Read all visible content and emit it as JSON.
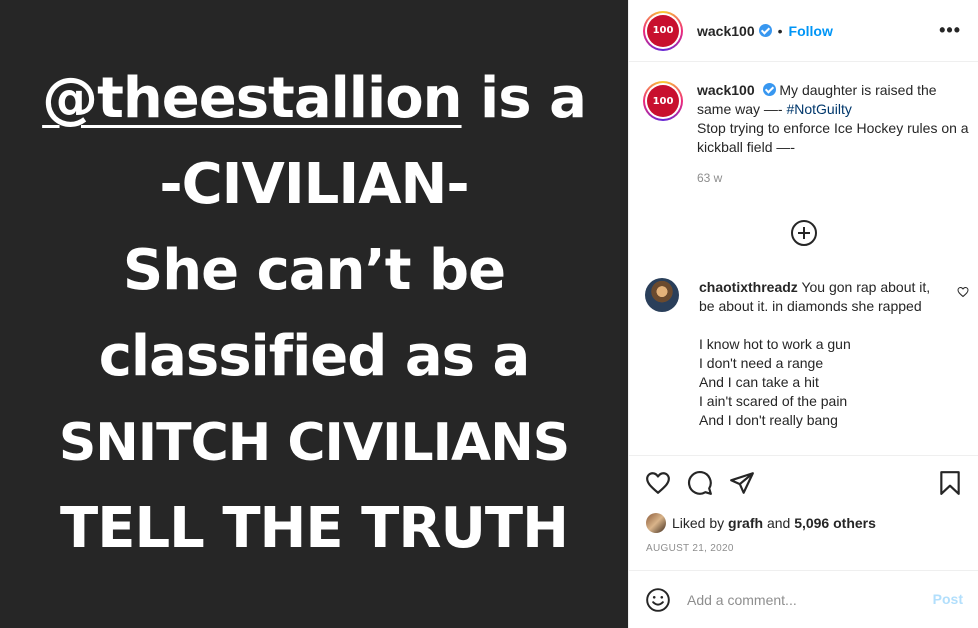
{
  "media": {
    "lines": {
      "mention": "@theestallion",
      "l1_rest": " is a",
      "l2": "-CIVILIAN-",
      "l3": "She can’t be",
      "l4": "classified as a",
      "l5": "SNITCH CIVILIANS",
      "l6": "TELL THE TRUTH"
    }
  },
  "header": {
    "username": "wack100",
    "separator": "•",
    "follow_label": "Follow",
    "more_label": "•••",
    "avatar_text": "100"
  },
  "caption": {
    "username": "wack100",
    "text_before_tag": "My daughter is raised the same way —- ",
    "hashtag": "#NotGuilty",
    "text_after": "Stop trying to enforce Ice Hockey rules on a kickball field —-",
    "time": "63 w"
  },
  "comment": {
    "username": "chaotixthreadz",
    "text": "You gon rap about it, be about it. in diamonds she rapped",
    "lines": [
      "I know hot to work a gun",
      "I don't need a range",
      "And I can take a hit",
      "I ain't scared of the pain",
      "And I don't really bang"
    ]
  },
  "actions": {
    "liked_by_prefix": "Liked by ",
    "liked_by_user": "grafh",
    "liked_by_mid": " and ",
    "likes_count": "5,096 others",
    "date": "AUGUST 21, 2020"
  },
  "composer": {
    "placeholder": "Add a comment...",
    "post_label": "Post"
  },
  "colors": {
    "link": "#0095f6",
    "hashtag": "#00376b",
    "muted": "#8e8e8e",
    "media_bg": "#262626"
  },
  "icons": [
    "heart-icon",
    "comment-icon",
    "share-icon",
    "bookmark-icon",
    "emoji-icon",
    "add-circle-icon",
    "more-icon",
    "verified-icon"
  ]
}
